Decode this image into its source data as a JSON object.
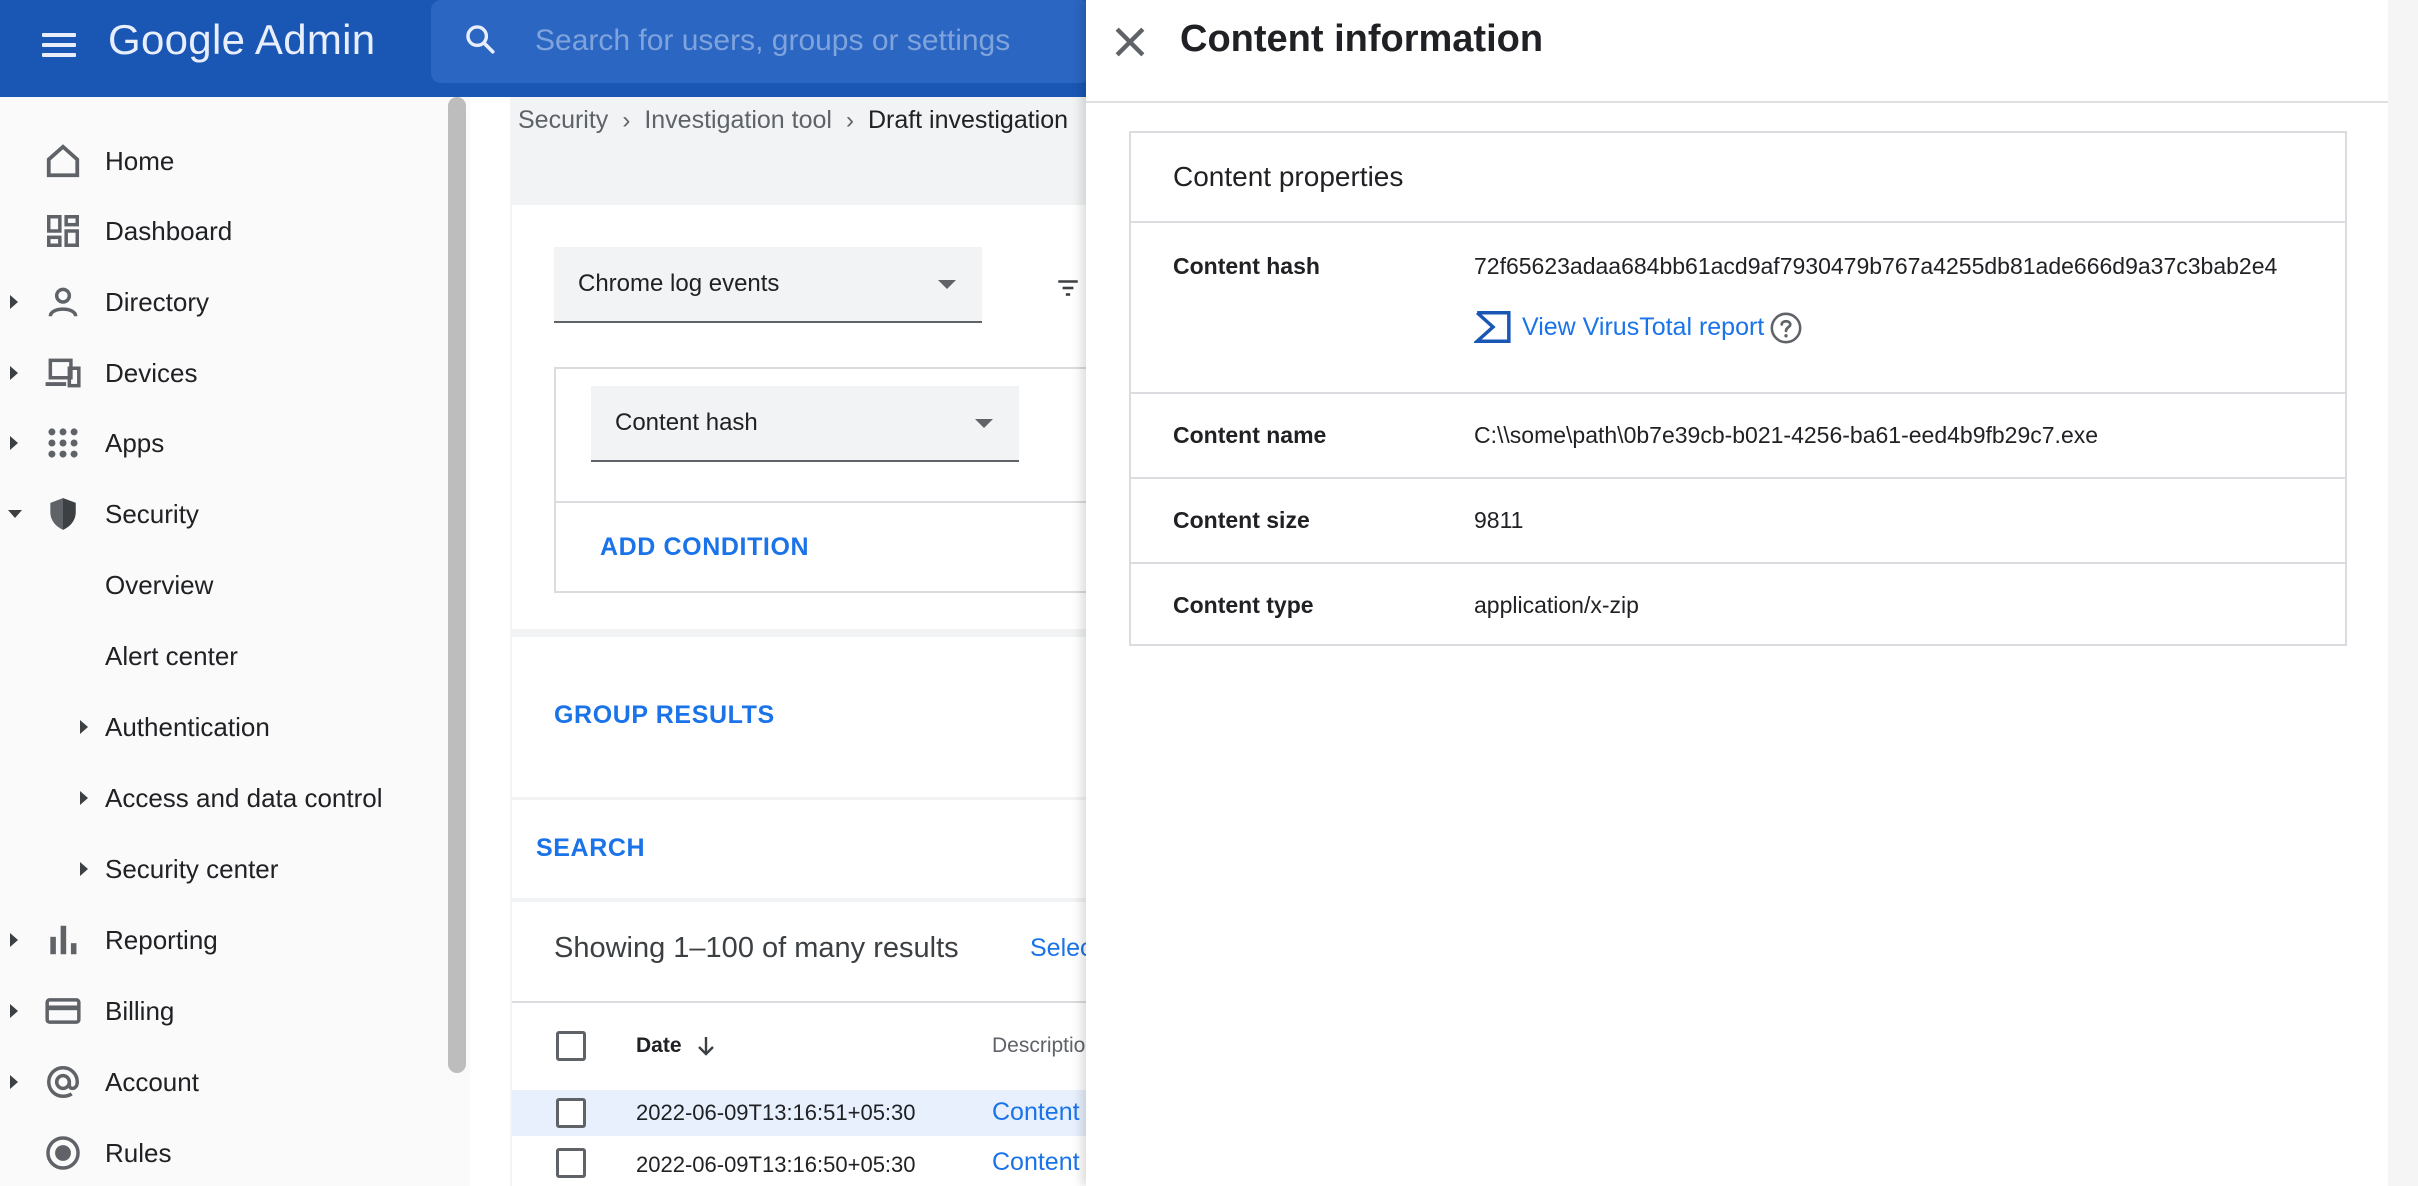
{
  "header": {
    "brand": "Google Admin",
    "search_placeholder": "Search for users, groups or settings"
  },
  "sidebar": {
    "items": [
      {
        "label": "Home",
        "icon": "home-icon"
      },
      {
        "label": "Dashboard",
        "icon": "dashboard-icon"
      },
      {
        "label": "Directory",
        "icon": "person-icon"
      },
      {
        "label": "Devices",
        "icon": "devices-icon"
      },
      {
        "label": "Apps",
        "icon": "apps-grid-icon"
      },
      {
        "label": "Security",
        "icon": "shield-icon"
      },
      {
        "label": "Reporting",
        "icon": "bar-chart-icon"
      },
      {
        "label": "Billing",
        "icon": "credit-card-icon"
      },
      {
        "label": "Account",
        "icon": "at-sign-icon"
      },
      {
        "label": "Rules",
        "icon": "rules-icon"
      }
    ],
    "security_sub": [
      {
        "label": "Overview"
      },
      {
        "label": "Alert center"
      },
      {
        "label": "Authentication"
      },
      {
        "label": "Access and data control"
      },
      {
        "label": "Security center"
      }
    ]
  },
  "breadcrumb": {
    "items": [
      "Security",
      "Investigation tool",
      "Draft investigation"
    ]
  },
  "main": {
    "data_source": "Chrome log events",
    "condition_field": "Content hash",
    "add_condition": "ADD CONDITION",
    "group_results": "GROUP RESULTS",
    "search": "SEARCH",
    "results_text": "Showing 1–100 of many results",
    "select_link": "Selec",
    "table": {
      "headers": {
        "date": "Date",
        "description": "Descriptio"
      },
      "rows": [
        {
          "date": "2022-06-09T13:16:51+05:30",
          "description": "Content"
        },
        {
          "date": "2022-06-09T13:16:50+05:30",
          "description": "Content"
        }
      ]
    }
  },
  "panel": {
    "title": "Content information",
    "section_title": "Content properties",
    "properties": {
      "hash_key": "Content hash",
      "hash_value": "72f65623adaa684bb61acd9af7930479b767a4255db81ade666d9a37c3bab2e4",
      "virustotal_link": "View VirusTotal report",
      "name_key": "Content name",
      "name_value": "C:\\\\some\\path\\0b7e39cb-b021-4256-ba61-eed4b9fb29c7.exe",
      "size_key": "Content size",
      "size_value": "9811",
      "type_key": "Content type",
      "type_value": "application/x-zip"
    }
  },
  "colors": {
    "topbar": "#1a57b4",
    "link": "#1a73e8"
  }
}
